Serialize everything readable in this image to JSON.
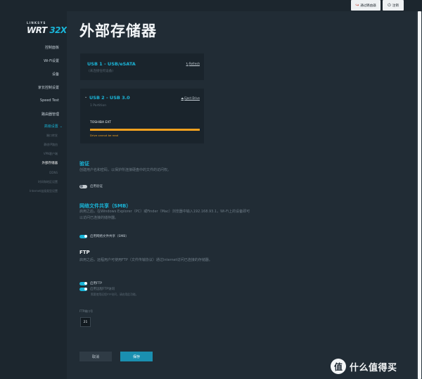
{
  "topbar": {
    "router_label": "通过路由器",
    "logout_label": "注销",
    "router_icon": "link-icon",
    "logout_icon": "power-icon"
  },
  "logo": {
    "brand": "LINKSYS",
    "model_prefix": "WRT ",
    "model_num": "32X"
  },
  "sidebar": {
    "items": [
      {
        "label": "控制面板"
      },
      {
        "label": "Wi-Fi设置"
      },
      {
        "label": "设备"
      },
      {
        "label": "家长控制设置"
      },
      {
        "label": "Speed Test"
      },
      {
        "label": "路由器管理"
      },
      {
        "label": "高级设置"
      }
    ],
    "subitems": [
      {
        "label": "端口转发"
      },
      {
        "label": "静态IP路由"
      },
      {
        "label": "VPN客户端"
      },
      {
        "label": "外部存储器"
      },
      {
        "label": "DDNS"
      },
      {
        "label": "时间和地区设置"
      },
      {
        "label": "Internet连接类型设置"
      }
    ]
  },
  "page": {
    "title": "外部存储器"
  },
  "usb1": {
    "title": "USB 1 - USB/eSATA",
    "status": "(未连接任何设备)",
    "refresh_label": "Refresh",
    "refresh_icon": "refresh-icon"
  },
  "usb2": {
    "title": "USB 2 - USB 3.0",
    "partitions": "1 Partition",
    "eject_label": "Eject Drive",
    "eject_icon": "eject-icon",
    "drive_name": "TOSHIBA EXT",
    "usage_fraction": 1.0,
    "warning": "Drive cannot be read"
  },
  "auth": {
    "title": "验证",
    "description": "创建用户名和密码，以保护所连接硬盘中的文件的访问权。",
    "toggle_label": "启用验证",
    "enabled": false
  },
  "smb": {
    "title": "网络文件共享（SMB）",
    "description": "启用之后，在Windows Explorer（PC）或Finder（Mac）浏览器中输入192.168.93.1，Wi-Fi上的设备即可以访问已连接的储存器。",
    "toggle_label": "启用网络文件共享（SMB）",
    "enabled": true
  },
  "ftp": {
    "title": "FTP",
    "description": "启用之后，远程用户可使用FTP（文件传输协议）通过Internet访问已连接的存储器。",
    "toggle_label": "启用FTP",
    "anon_label": "启用远程FTP访问",
    "anon_hint": "需要使用远程FTP访问，请启用此功能。",
    "port_label": "FTP端口号",
    "port_value": "21",
    "enabled": true
  },
  "actions": {
    "cancel_label": "取消",
    "save_label": "保存"
  },
  "watermark": {
    "glyph": "值",
    "text": "什么值得买"
  },
  "colors": {
    "accent": "#1ab5d8",
    "warning": "#f2a11f",
    "background": "#1f2a34"
  }
}
